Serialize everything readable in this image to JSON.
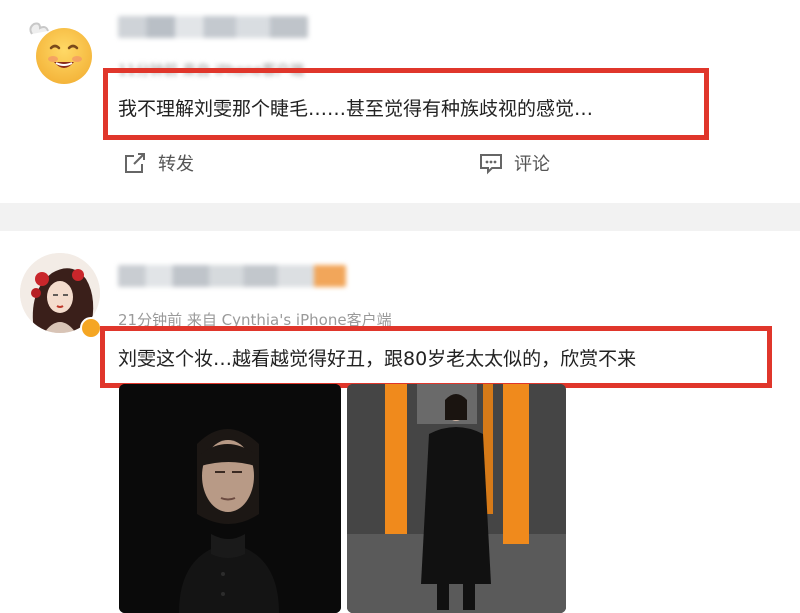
{
  "post1": {
    "username": "",
    "meta": "11分钟前 来自 iPhone客户端",
    "text": "我不理解刘雯那个睫毛……甚至觉得有种族歧视的感觉…",
    "actions": {
      "repost_label": "转发",
      "comment_label": "评论"
    }
  },
  "post2": {
    "username": "",
    "meta": "21分钟前 来自 Cynthia's iPhone客户端",
    "text": "刘雯这个妆…越看越觉得好丑，跟80岁老太太似的，欣赏不来",
    "verified": true
  },
  "colors": {
    "highlight": "#e0362b",
    "badge": "#f5a623",
    "pillar": "#f08a1c",
    "background": "#ffffff",
    "separator": "#f2f2f2"
  },
  "icons": {
    "repost": "share-icon",
    "comment": "comment-icon",
    "verified": "verified-badge-icon"
  }
}
